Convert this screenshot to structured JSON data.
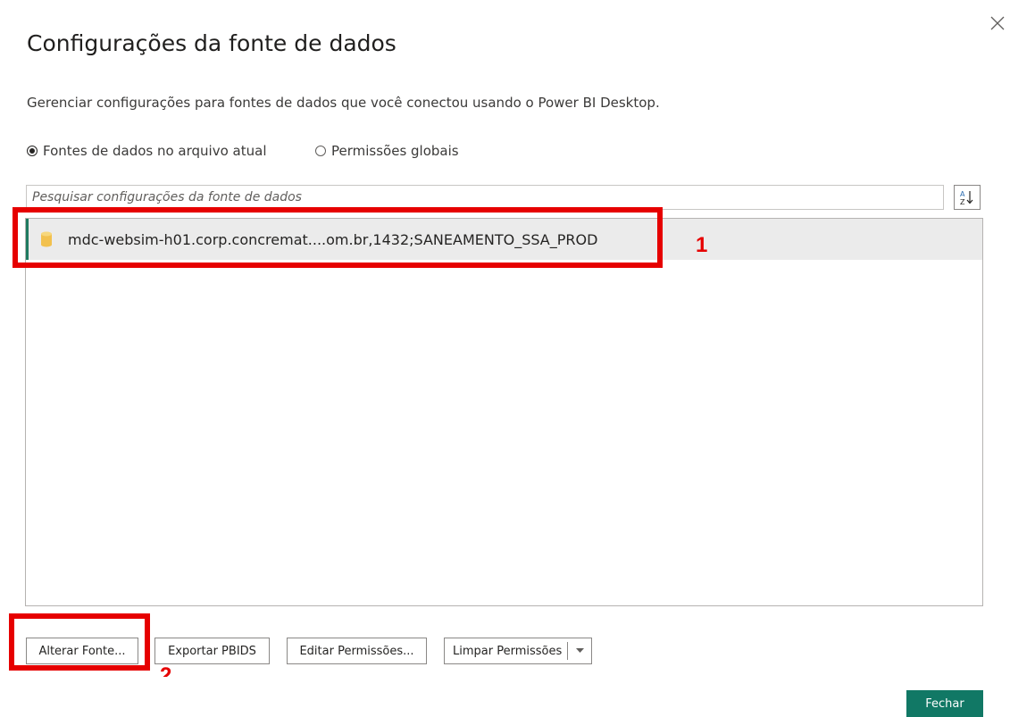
{
  "dialog": {
    "title": "Configurações da fonte de dados",
    "subtitle": "Gerenciar configurações para fontes de dados que você conectou usando o Power BI Desktop.",
    "close_icon": "close-icon"
  },
  "scope": {
    "options": [
      {
        "label": "Fontes de dados no arquivo atual",
        "checked": true
      },
      {
        "label": "Permissões globais",
        "checked": false
      }
    ]
  },
  "search": {
    "placeholder": "Pesquisar configurações da fonte de dados",
    "value": ""
  },
  "sort_icon": "sort-az-icon",
  "sources": [
    {
      "label": "mdc-websim-h01.corp.concremat....om.br,1432;SANEAMENTO_SSA_PROD",
      "icon": "database-icon",
      "selected": true
    }
  ],
  "annotations": {
    "marker_1": "1",
    "marker_2": "2"
  },
  "actions": {
    "change_source": "Alterar Fonte...",
    "export_pbids": "Exportar PBIDS",
    "edit_permissions": "Editar Permissões...",
    "clear_permissions": "Limpar Permissões",
    "close": "Fechar"
  },
  "colors": {
    "accent": "#117865",
    "selection_bar": "#1f7a60",
    "annotation": "#e60000",
    "database_icon": "#f2c14e"
  }
}
